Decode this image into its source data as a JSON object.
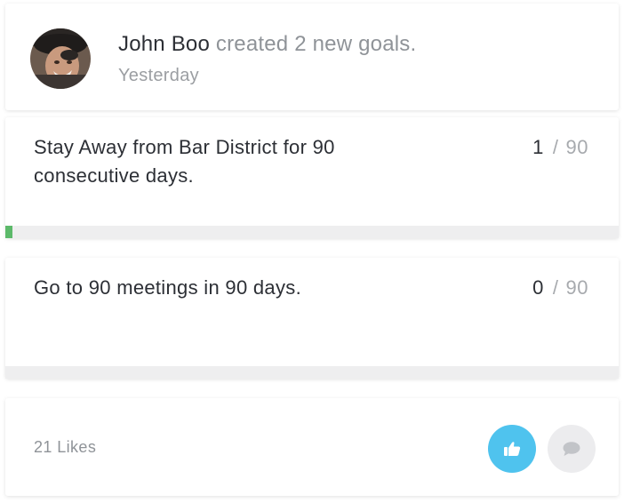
{
  "activity": {
    "user_name": "John Boo",
    "action": "created 2 new goals.",
    "time": "Yesterday"
  },
  "goals": [
    {
      "title": "Stay Away from Bar District for 90 consecutive days.",
      "current": "1",
      "separator": "/",
      "total": "90",
      "progress": 0.011
    },
    {
      "title": "Go to 90 meetings in 90 days.",
      "current": "0",
      "separator": "/",
      "total": "90",
      "progress": 0
    }
  ],
  "footer": {
    "likes_label": "21 Likes",
    "like_icon": "thumbs-up-icon",
    "comment_icon": "comment-bubble-icon"
  },
  "colors": {
    "progress": "#5cb96a",
    "like_button": "#4fc3ee",
    "comment_button": "#ececee"
  }
}
